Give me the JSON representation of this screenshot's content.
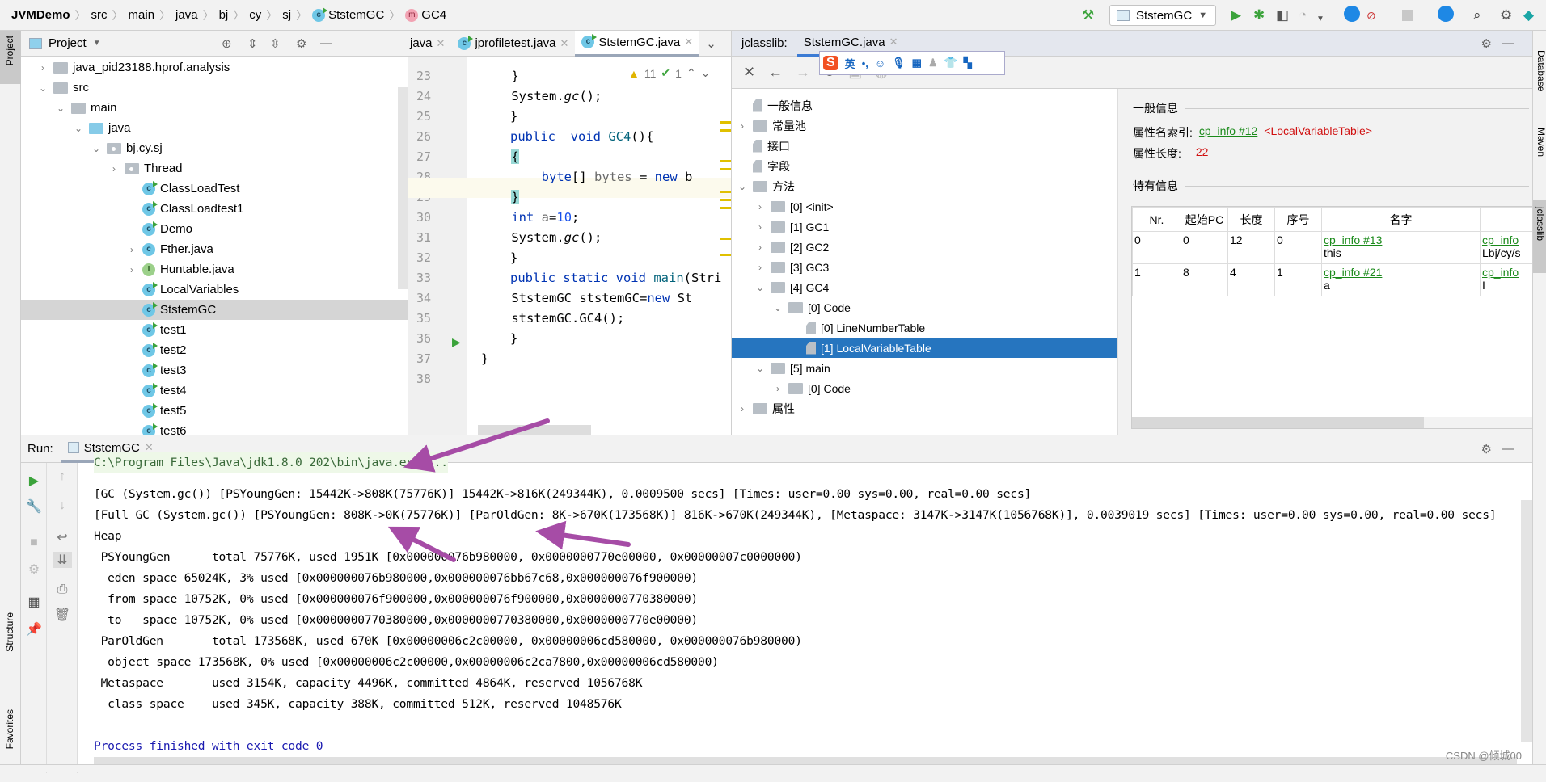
{
  "breadcrumb": [
    "JVMDemo",
    "src",
    "main",
    "java",
    "bj",
    "cy",
    "sj",
    "StstemGC",
    "GC4"
  ],
  "toolbar": {
    "run_config": "StstemGC"
  },
  "left_strip": {
    "project": "Project",
    "structure": "Structure",
    "favorites": "Favorites"
  },
  "right_strip": {
    "database": "Database",
    "maven": "Maven",
    "jclasslib": "jclasslib"
  },
  "project": {
    "title": "Project",
    "tree": [
      {
        "label": "java_pid23188.hprof.analysis",
        "icon": "folder",
        "chev": ">"
      },
      {
        "label": "src",
        "icon": "folder",
        "chev": "v"
      },
      {
        "label": "main",
        "icon": "folder",
        "chev": "v"
      },
      {
        "label": "java",
        "icon": "source-folder",
        "chev": "v"
      },
      {
        "label": "bj.cy.sj",
        "icon": "package",
        "chev": "v"
      },
      {
        "label": "Thread",
        "icon": "package",
        "chev": ">"
      },
      {
        "label": "ClassLoadTest",
        "icon": "class-run"
      },
      {
        "label": "ClassLoadtest1",
        "icon": "class-run"
      },
      {
        "label": "Demo",
        "icon": "class-run"
      },
      {
        "label": "Fther.java",
        "icon": "class",
        "chev": ">"
      },
      {
        "label": "Huntable.java",
        "icon": "interface",
        "chev": ">"
      },
      {
        "label": "LocalVariables",
        "icon": "class-run"
      },
      {
        "label": "StstemGC",
        "icon": "class-run",
        "selected": true
      },
      {
        "label": "test1",
        "icon": "class-run"
      },
      {
        "label": "test2",
        "icon": "class-run"
      },
      {
        "label": "test3",
        "icon": "class-run"
      },
      {
        "label": "test4",
        "icon": "class-run"
      },
      {
        "label": "test5",
        "icon": "class-run"
      },
      {
        "label": "test6",
        "icon": "class-run"
      }
    ]
  },
  "editor": {
    "tabs": [
      "java",
      "jprofiletest.java",
      "StstemGC.java"
    ],
    "active_tab": 2,
    "inspections": {
      "warnings": "11",
      "ok": "1"
    },
    "line_numbers": [
      "23",
      "24",
      "25",
      "26",
      "27",
      "28",
      "29",
      "30",
      "31",
      "32",
      "33",
      "34",
      "35",
      "36",
      "37",
      "38"
    ]
  },
  "jclasslib": {
    "tab_prefix": "jclasslib:",
    "tab": "StstemGC.java",
    "ime": {
      "mode": "英",
      "punct": "•,"
    },
    "tree": [
      {
        "label": "一般信息",
        "icon": "file",
        "level": 0
      },
      {
        "label": "常量池",
        "icon": "folder",
        "level": 0,
        "chev": ">"
      },
      {
        "label": "接口",
        "icon": "file",
        "level": 0
      },
      {
        "label": "字段",
        "icon": "file",
        "level": 0
      },
      {
        "label": "方法",
        "icon": "folder",
        "level": 0,
        "chev": "v"
      },
      {
        "label": "[0] <init>",
        "icon": "folder",
        "level": 1,
        "chev": ">"
      },
      {
        "label": "[1] GC1",
        "icon": "folder",
        "level": 1,
        "chev": ">"
      },
      {
        "label": "[2] GC2",
        "icon": "folder",
        "level": 1,
        "chev": ">"
      },
      {
        "label": "[3] GC3",
        "icon": "folder",
        "level": 1,
        "chev": ">"
      },
      {
        "label": "[4] GC4",
        "icon": "folder",
        "level": 1,
        "chev": "v"
      },
      {
        "label": "[0] Code",
        "icon": "folder",
        "level": 2,
        "chev": "v"
      },
      {
        "label": "[0] LineNumberTable",
        "icon": "file",
        "level": 3
      },
      {
        "label": "[1] LocalVariableTable",
        "icon": "file",
        "level": 3,
        "selected": true
      },
      {
        "label": "[5] main",
        "icon": "folder",
        "level": 1,
        "chev": "v"
      },
      {
        "label": "[0] Code",
        "icon": "folder",
        "level": 2,
        "chev": ">"
      },
      {
        "label": "属性",
        "icon": "folder",
        "level": 0,
        "chev": ">"
      }
    ],
    "detail": {
      "general_title": "一般信息",
      "name_index_label": "属性名索引:",
      "name_index_link": "cp_info #12",
      "name_index_value": "<LocalVariableTable>",
      "length_label": "属性长度:",
      "length_value": "22",
      "specific_title": "特有信息",
      "columns": [
        "Nr.",
        "起始PC",
        "长度",
        "序号",
        "名字",
        ""
      ],
      "rows": [
        {
          "nr": "0",
          "start_pc": "0",
          "length": "12",
          "index": "0",
          "name_link": "cp_info #13",
          "name": "this",
          "desc_link": "cp_info",
          "desc": "Lbj/cy/s"
        },
        {
          "nr": "1",
          "start_pc": "8",
          "length": "4",
          "index": "1",
          "name_link": "cp_info #21",
          "name": "a",
          "desc_link": "cp_info",
          "desc": "I"
        }
      ]
    }
  },
  "run": {
    "label": "Run:",
    "tab": "StstemGC",
    "lines": [
      "C:\\Program Files\\Java\\jdk1.8.0_202\\bin\\java.exe ...",
      "[GC (System.gc()) [PSYoungGen: 15442K->808K(75776K)] 15442K->816K(249344K), 0.0009500 secs] [Times: user=0.00 sys=0.00, real=0.00 secs]",
      "[Full GC (System.gc()) [PSYoungGen: 808K->0K(75776K)] [ParOldGen: 8K->670K(173568K)] 816K->670K(249344K), [Metaspace: 3147K->3147K(1056768K)], 0.0039019 secs] [Times: user=0.00 sys=0.00, real=0.00 secs]",
      "Heap",
      " PSYoungGen      total 75776K, used 1951K [0x000000076b980000, 0x0000000770e00000, 0x00000007c0000000)",
      "  eden space 65024K, 3% used [0x000000076b980000,0x000000076bb67c68,0x000000076f900000)",
      "  from space 10752K, 0% used [0x000000076f900000,0x000000076f900000,0x0000000770380000)",
      "  to   space 10752K, 0% used [0x0000000770380000,0x0000000770380000,0x0000000770e00000)",
      " ParOldGen       total 173568K, used 670K [0x00000006c2c00000, 0x00000006cd580000, 0x000000076b980000)",
      "  object space 173568K, 0% used [0x00000006c2c00000,0x00000006c2ca7800,0x00000006cd580000)",
      " Metaspace       used 3154K, capacity 4496K, committed 4864K, reserved 1056768K",
      "  class space    used 345K, capacity 388K, committed 512K, reserved 1048576K",
      "",
      "Process finished with exit code 0"
    ]
  },
  "watermark": "CSDN @倾城00",
  "colors": {
    "selection": "#2675bf",
    "link": "#1a8a1a",
    "accent_arrow": "#a64ca6",
    "exit_text": "#1a1ab0"
  }
}
